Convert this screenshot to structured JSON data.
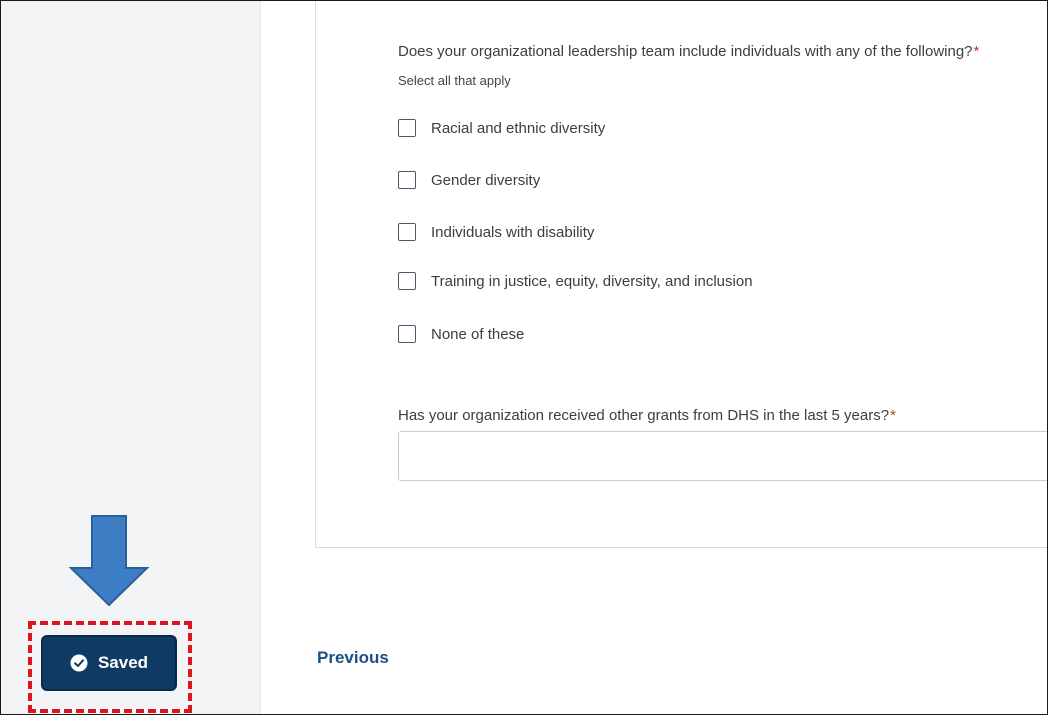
{
  "form": {
    "question1": {
      "label": "Does your organizational leadership team include individuals with any of the following?",
      "required_mark": "*",
      "hint": "Select all that apply",
      "options": [
        {
          "label": "Racial and ethnic diversity",
          "checked": false
        },
        {
          "label": "Gender diversity",
          "checked": false
        },
        {
          "label": "Individuals with disability",
          "checked": false
        },
        {
          "label": "Training in justice, equity, diversity, and inclusion",
          "checked": false
        },
        {
          "label": "None of these",
          "checked": false
        }
      ]
    },
    "question2": {
      "label": "Has your organization received other grants from DHS in the last 5 years?",
      "required_mark": "*",
      "value": "",
      "placeholder": ""
    }
  },
  "nav": {
    "previous_label": "Previous"
  },
  "status": {
    "saved_label": "Saved",
    "icon": "check-circle-icon"
  },
  "annotation": {
    "arrow_color": "#3d7dc4",
    "highlight_color": "#e0141b"
  },
  "colors": {
    "primary": "#0f3a63",
    "link": "#1d4f86",
    "required": "#c0392b"
  }
}
